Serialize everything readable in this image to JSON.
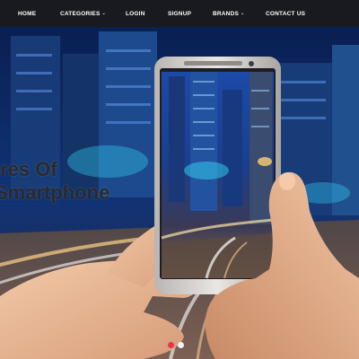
{
  "nav": {
    "items": [
      {
        "label": "HOME",
        "dropdown": false
      },
      {
        "label": "CATEGORIES",
        "dropdown": true
      },
      {
        "label": "LOGIN",
        "dropdown": false
      },
      {
        "label": "SIGNUP",
        "dropdown": false
      },
      {
        "label": "BRANDS",
        "dropdown": true
      },
      {
        "label": "CONTACT US",
        "dropdown": false
      }
    ],
    "caret_icon": "chevron-down-icon",
    "background": "#181a1f",
    "text_color": "#ffffff"
  },
  "hero": {
    "title_line1": "ires Of",
    "title_line2": "Smartphone",
    "slides": {
      "count": 2,
      "active_index": 0
    },
    "dot_active_color": "#e8334a",
    "dot_idle_color": "#f2f2f2"
  }
}
